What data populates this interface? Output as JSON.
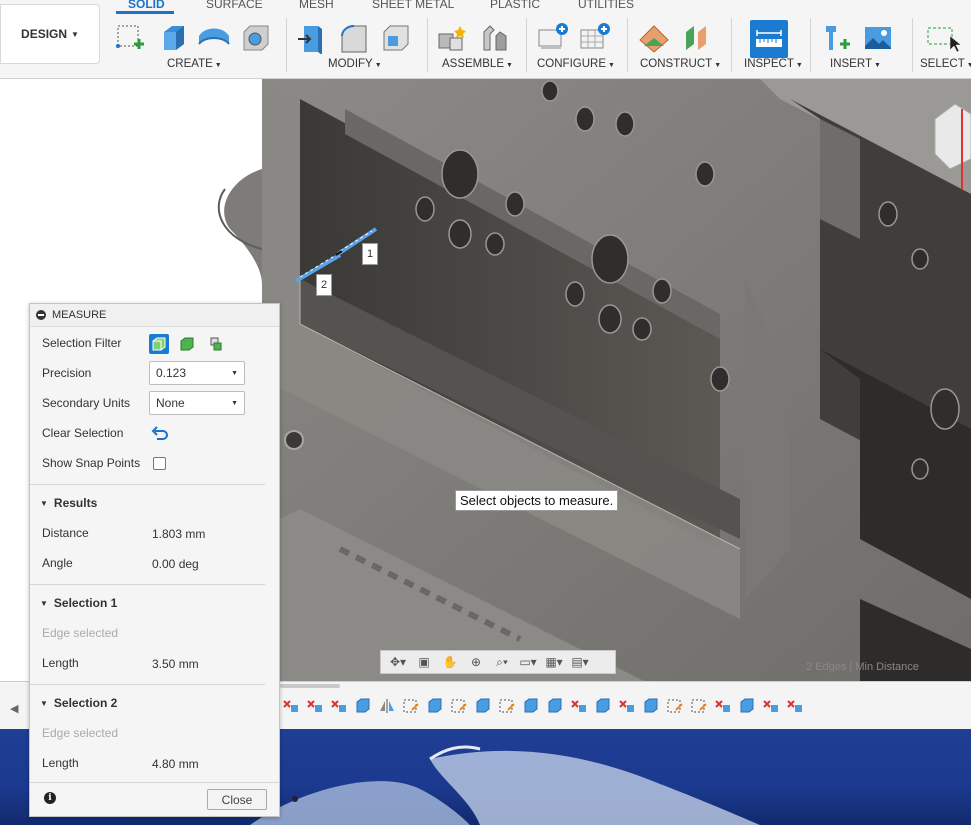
{
  "toolbar": {
    "workspace": "DESIGN",
    "tabs": [
      "SOLID",
      "SURFACE",
      "MESH",
      "SHEET METAL",
      "PLASTIC",
      "UTILITIES"
    ],
    "groups": [
      "CREATE",
      "MODIFY",
      "ASSEMBLE",
      "CONFIGURE",
      "CONSTRUCT",
      "INSPECT",
      "INSERT",
      "SELECT"
    ]
  },
  "viewport": {
    "tooltip": "Select objects to measure.",
    "status": "2 Edges | Min Distance",
    "dimension_text": "1.803",
    "marker1": "1",
    "marker2": "2"
  },
  "measure": {
    "title": "MEASURE",
    "selection_filter_label": "Selection Filter",
    "precision_label": "Precision",
    "precision_value": "0.123",
    "secondary_units_label": "Secondary Units",
    "secondary_units_value": "None",
    "clear_selection_label": "Clear Selection",
    "show_snap_points_label": "Show Snap Points",
    "results_label": "Results",
    "distance_label": "Distance",
    "distance_value": "1.803 mm",
    "angle_label": "Angle",
    "angle_value": "0.00 deg",
    "selection1_label": "Selection 1",
    "selection1_type": "Edge selected",
    "selection1_length_label": "Length",
    "selection1_length_value": "3.50 mm",
    "selection2_label": "Selection 2",
    "selection2_type": "Edge selected",
    "selection2_length_label": "Length",
    "selection2_length_value": "4.80 mm",
    "close_label": "Close"
  },
  "colors": {
    "accent": "#1a73c8",
    "desktop": "#1f3e94"
  }
}
